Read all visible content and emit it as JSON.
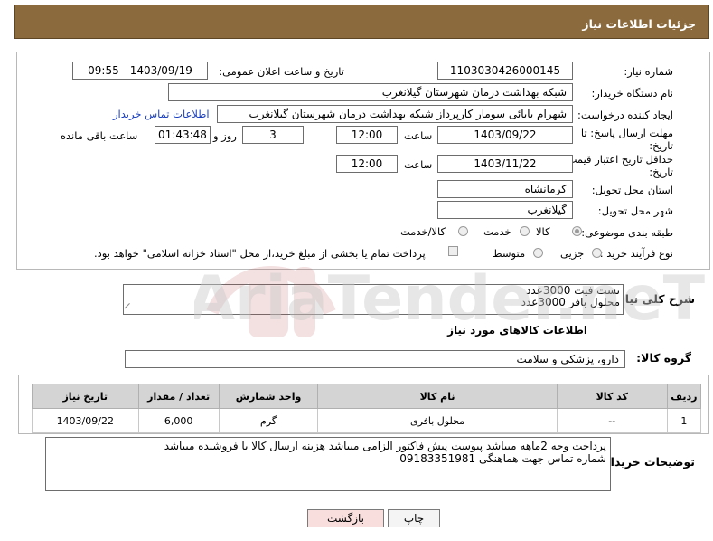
{
  "header": {
    "title": "جزئیات اطلاعات نیاز"
  },
  "form": {
    "need_number_label": "شماره نیاز:",
    "need_number": "1103030426000145",
    "announce_label": "تاریخ و ساعت اعلان عمومی:",
    "announce_value": "1403/09/19 - 09:55",
    "buyer_org_label": "نام دستگاه خریدار:",
    "buyer_org": "شبکه بهداشت درمان شهرستان گیلانغرب",
    "requester_label": "ایجاد کننده درخواست:",
    "requester": "شهرام بابائی سومار کارپرداز شبکه بهداشت درمان شهرستان گیلانغرب",
    "buyer_contact_link": "اطلاعات تماس خریدار",
    "reply_deadline_label_1": "مهلت ارسال پاسخ: تا",
    "reply_deadline_label_2": "تاریخ:",
    "reply_date": "1403/09/22",
    "time_label": "ساعت",
    "reply_time": "12:00",
    "days_value": "3",
    "days_label": "روز و",
    "remaining_time": "01:43:48",
    "remaining_label": "ساعت باقی مانده",
    "price_validity_label_1": "حداقل تاریخ اعتبار قیمت: تا",
    "price_validity_label_2": "تاریخ:",
    "price_date": "1403/11/22",
    "price_time": "12:00",
    "province_label": "استان محل تحویل:",
    "province": "کرمانشاه",
    "city_label": "شهر محل تحویل:",
    "city": "گیلانغرب",
    "category_label": "طبقه بندی موضوعی:",
    "category_options": [
      "کالا",
      "خدمت",
      "کالا/خدمت"
    ],
    "process_label": "نوع فرآیند خرید :",
    "process_options": [
      "جزیی",
      "متوسط"
    ],
    "payment_note": "پرداخت تمام یا بخشی از مبلغ خرید،از محل \"اسناد خزانه اسلامی\" خواهد بود."
  },
  "summary": {
    "label": "شرح کلی نیاز:",
    "line1": "تست فیت 3000عدد",
    "line2": "محلول بافر 3000عدد"
  },
  "goods": {
    "section_title": "اطلاعات کالاهای مورد نیاز",
    "group_label": "گروه کالا:",
    "group_value": "دارو، پزشکی و سلامت",
    "columns": [
      "ردیف",
      "کد کالا",
      "نام کالا",
      "واحد شمارش",
      "تعداد / مقدار",
      "تاریخ نیاز"
    ],
    "rows": [
      {
        "row": "1",
        "code": "--",
        "name": "محلول بافری",
        "unit": "گرم",
        "qty": "6,000",
        "date": "1403/09/22"
      }
    ]
  },
  "buyer_notes": {
    "label": "توضیحات خریدار:",
    "line1": "پرداخت وجه 2ماهه میباشد پیوست پیش فاکتور الزامی میباشد هزینه ارسال کالا با فروشنده میباشد",
    "line2": "شماره تماس جهت هماهنگی 09183351981"
  },
  "buttons": {
    "print": "چاپ",
    "back": "بازگشت"
  },
  "watermark": {
    "text": "AriaTender.neT"
  }
}
